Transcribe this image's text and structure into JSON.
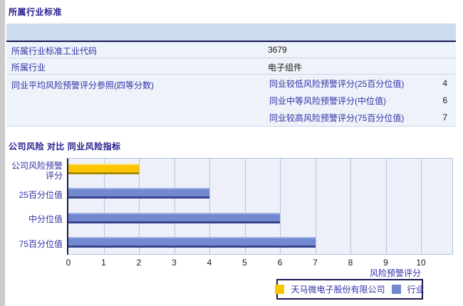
{
  "section1": {
    "title": "所属行业标准",
    "rows": [
      {
        "label": "所属行业标准工业代码",
        "value": "3679"
      },
      {
        "label": "所属行业",
        "value": "电子组件"
      }
    ],
    "group_row": {
      "label": "同业平均风险预警评分参照(四等分数)",
      "sub_rows": [
        {
          "label": "同业较低风险预警评分(25百分位值)",
          "value": "4"
        },
        {
          "label": "同业中等风险预警评分(中位值)",
          "value": "6"
        },
        {
          "label": "同业较高风险预警评分(75百分位值)",
          "value": "7"
        }
      ]
    }
  },
  "section2": {
    "title": "公司风险 对比 同业风险指标"
  },
  "chart_data": {
    "type": "bar",
    "orientation": "horizontal",
    "title": "",
    "xlabel": "风险预警评分",
    "ylabel": "",
    "xlim": [
      0,
      10
    ],
    "xticks": [
      0,
      1,
      2,
      3,
      4,
      5,
      6,
      7,
      8,
      9,
      10
    ],
    "grid": true,
    "categories": [
      "公司风险预警\n评分",
      "25百分位值",
      "中分位值",
      "75百分位值"
    ],
    "values": [
      2,
      4,
      6,
      7
    ],
    "bar_series_index": [
      0,
      1,
      1,
      1
    ],
    "series": [
      {
        "name": "天马微电子股份有限公司",
        "fill": "#FDC500",
        "edge_light": "#FFE37A",
        "edge_dark": "#A98B00"
      },
      {
        "name": "行业",
        "fill": "#7289D0",
        "edge_light": "#9FB0E2",
        "edge_dark": "#3A458E"
      }
    ],
    "legend_position": "bottom",
    "plot_bg": "#EDF0F8",
    "gridline_color": "#B4C2E2",
    "axis_color": "#191955"
  },
  "colors": {
    "section_title": "#221C8E",
    "label_text": "#3030A8",
    "value_text": "#1A1A1A",
    "table_header_bg": "#CDDCF0",
    "table_row_bg": "#EEF2F9",
    "table_divider": "#C9D7EB",
    "dark_border": "#191955"
  }
}
